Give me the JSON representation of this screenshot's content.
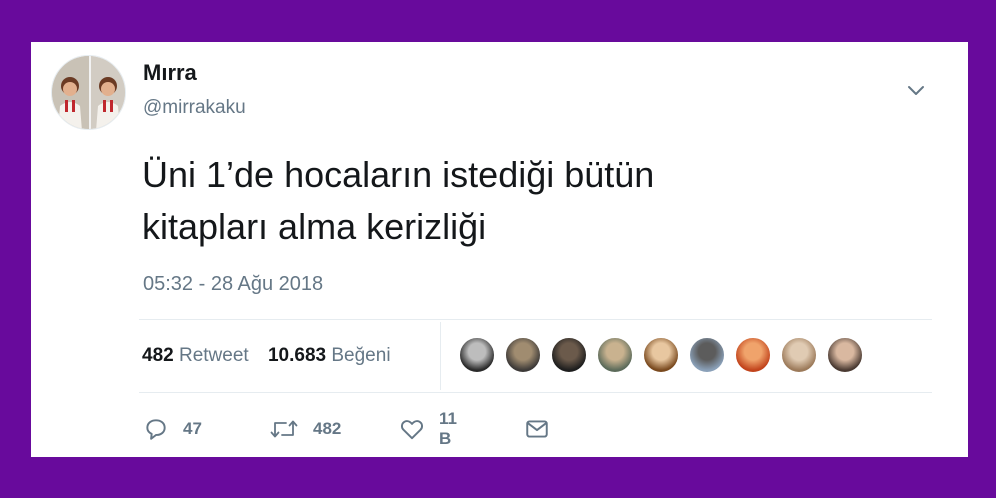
{
  "author": {
    "display_name": "Mırra",
    "handle": "@mirrakaku"
  },
  "tweet": {
    "text_line1": "Üni 1’de hocaların istediği bütün",
    "text_line2": "kitapları alma kerizliği",
    "timestamp": "05:32 - 28 Ağu 2018"
  },
  "stats": {
    "retweets_count": "482",
    "retweets_label": "Retweet",
    "likes_count": "10.683",
    "likes_label": "Beğeni"
  },
  "actions": {
    "reply_count": "47",
    "retweet_count": "482",
    "like_count": "11 B"
  },
  "icons": {
    "menu": "chevron-down-icon",
    "reply": "speech-bubble-icon",
    "retweet": "retweet-arrows-icon",
    "like": "heart-icon",
    "dm": "envelope-icon"
  },
  "colors": {
    "background": "#680a9c",
    "card": "#ffffff",
    "text_primary": "#14171a",
    "text_secondary": "#657786",
    "divider": "#e6ecf0"
  },
  "liker_avatars": [
    {
      "colors": [
        "#2a2a2a",
        "#bdbdbd"
      ]
    },
    {
      "colors": [
        "#3d3a38",
        "#a08c70"
      ]
    },
    {
      "colors": [
        "#1e1e1e",
        "#6b5a4b"
      ]
    },
    {
      "colors": [
        "#5c6b5a",
        "#c9b28f"
      ]
    },
    {
      "colors": [
        "#7a4a1f",
        "#e8c7a0"
      ]
    },
    {
      "colors": [
        "#8aa0b8",
        "#5c5c5c"
      ]
    },
    {
      "colors": [
        "#c2441c",
        "#f0a36b"
      ]
    },
    {
      "colors": [
        "#9c7a5a",
        "#e0cbb3"
      ]
    },
    {
      "colors": [
        "#4a3a32",
        "#d9b8a0"
      ]
    }
  ]
}
